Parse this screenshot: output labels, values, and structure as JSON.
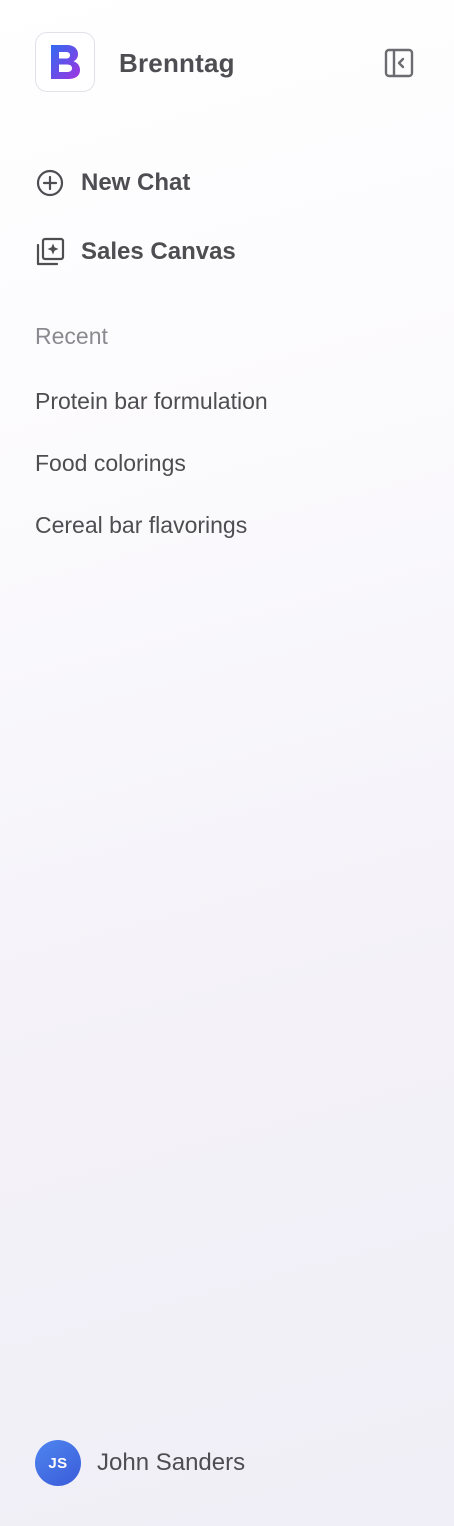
{
  "brand": {
    "name": "Brenntag",
    "logo_letter": "B",
    "logo_gradient": [
      "#2f6bf2",
      "#a133e0"
    ]
  },
  "header": {
    "collapse_icon": "sidebar-collapse-icon"
  },
  "nav": [
    {
      "label": "New Chat",
      "icon": "plus-circle-icon"
    },
    {
      "label": "Sales Canvas",
      "icon": "sparkle-gallery-icon"
    }
  ],
  "recent": {
    "title": "Recent",
    "items": [
      "Protein bar formulation",
      "Food colorings",
      "Cereal bar flavorings"
    ]
  },
  "user": {
    "initials": "JS",
    "name": "John Sanders",
    "avatar_color": "#4472e6"
  }
}
